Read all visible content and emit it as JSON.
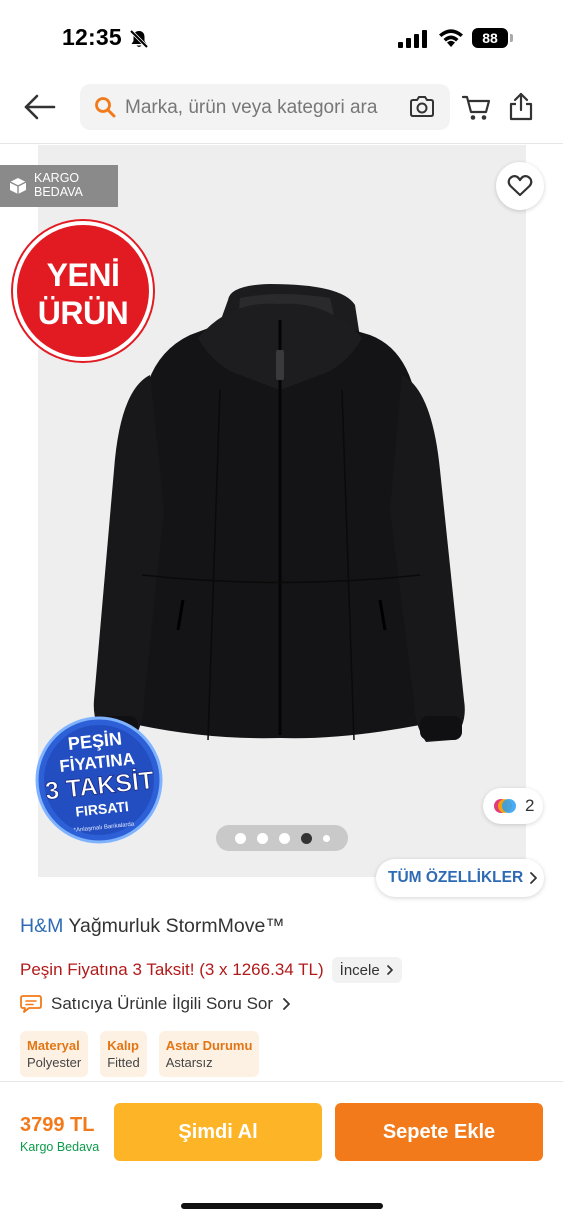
{
  "status_bar": {
    "time": "12:35",
    "battery": "88"
  },
  "header": {
    "search_placeholder": "Marka, ürün veya kategori ara",
    "icons": [
      "back-arrow-icon",
      "search-icon",
      "camera-icon",
      "cart-icon",
      "share-icon"
    ]
  },
  "gallery": {
    "cargo_badge_line1": "KARGO",
    "cargo_badge_line2": "BEDAVA",
    "new_badge_line1": "YENİ",
    "new_badge_line2": "ÜRÜN",
    "installment_badge_line1": "PEŞİN",
    "installment_badge_line2": "FİYATINA",
    "installment_badge_line3": "3 TAKSİT",
    "installment_badge_line4": "FIRSATI",
    "installment_badge_note": "*Anlaşmalı Bankalarda",
    "color_count": "2",
    "pages_total": 5,
    "active_page": 4,
    "all_features_label": "TÜM ÖZELLİKLER"
  },
  "product": {
    "brand": "H&M",
    "name": "Yağmurluk StormMove™",
    "installment_text": "Peşin Fiyatına 3 Taksit! (3 x 1266.34 TL)",
    "incele_label": "İncele",
    "question_label": "Satıcıya Ürünle İlgili Soru Sor",
    "attributes": [
      {
        "name": "Materyal",
        "value": "Polyester"
      },
      {
        "name": "Kalıp",
        "value": "Fitted"
      },
      {
        "name": "Astar Durumu",
        "value": "Astarsız"
      }
    ]
  },
  "bottom_bar": {
    "price": "3799 TL",
    "cargo": "Kargo Bedava",
    "buy_now_label": "Şimdi Al",
    "add_to_cart_label": "Sepete Ekle"
  },
  "colors": {
    "accent_orange": "#f27a1a",
    "buy_yellow": "#fdb426",
    "brand_blue": "#2e6bb4",
    "installment_red": "#b21a1a",
    "new_badge_red": "#e21b23",
    "free_cargo_green": "#0c9b4a"
  }
}
